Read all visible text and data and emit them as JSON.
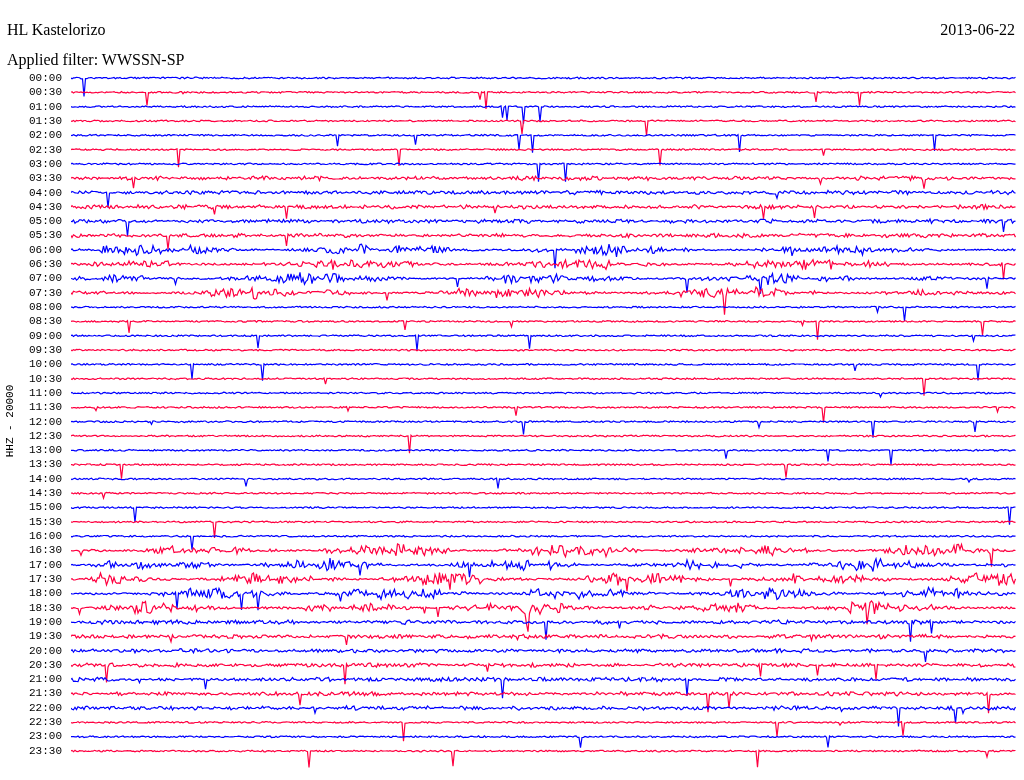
{
  "header": {
    "station": "HL Kastelorizo",
    "date": "2013-06-22",
    "filter": "Applied filter: WWSSN-SP"
  },
  "plot": {
    "axis_label": "HHZ - 20000",
    "rows": [
      {
        "time": "00:00",
        "color": "#0000ff"
      },
      {
        "time": "00:30",
        "color": "#ff0040"
      },
      {
        "time": "01:00",
        "color": "#0000ff"
      },
      {
        "time": "01:30",
        "color": "#ff0040"
      },
      {
        "time": "02:00",
        "color": "#0000ff"
      },
      {
        "time": "02:30",
        "color": "#ff0040"
      },
      {
        "time": "03:00",
        "color": "#0000ff"
      },
      {
        "time": "03:30",
        "color": "#ff0040"
      },
      {
        "time": "04:00",
        "color": "#0000ff"
      },
      {
        "time": "04:30",
        "color": "#ff0040"
      },
      {
        "time": "05:00",
        "color": "#0000ff"
      },
      {
        "time": "05:30",
        "color": "#ff0040"
      },
      {
        "time": "06:00",
        "color": "#0000ff"
      },
      {
        "time": "06:30",
        "color": "#ff0040"
      },
      {
        "time": "07:00",
        "color": "#0000ff"
      },
      {
        "time": "07:30",
        "color": "#ff0040"
      },
      {
        "time": "08:00",
        "color": "#0000ff"
      },
      {
        "time": "08:30",
        "color": "#ff0040"
      },
      {
        "time": "09:00",
        "color": "#0000ff"
      },
      {
        "time": "09:30",
        "color": "#ff0040"
      },
      {
        "time": "10:00",
        "color": "#0000ff"
      },
      {
        "time": "10:30",
        "color": "#ff0040"
      },
      {
        "time": "11:00",
        "color": "#0000ff"
      },
      {
        "time": "11:30",
        "color": "#ff0040"
      },
      {
        "time": "12:00",
        "color": "#0000ff"
      },
      {
        "time": "12:30",
        "color": "#ff0040"
      },
      {
        "time": "13:00",
        "color": "#0000ff"
      },
      {
        "time": "13:30",
        "color": "#ff0040"
      },
      {
        "time": "14:00",
        "color": "#0000ff"
      },
      {
        "time": "14:30",
        "color": "#ff0040"
      },
      {
        "time": "15:00",
        "color": "#0000ff"
      },
      {
        "time": "15:30",
        "color": "#ff0040"
      },
      {
        "time": "16:00",
        "color": "#0000ff"
      },
      {
        "time": "16:30",
        "color": "#ff0040"
      },
      {
        "time": "17:00",
        "color": "#0000ff"
      },
      {
        "time": "17:30",
        "color": "#ff0040"
      },
      {
        "time": "18:00",
        "color": "#0000ff"
      },
      {
        "time": "18:30",
        "color": "#ff0040"
      },
      {
        "time": "19:00",
        "color": "#0000ff"
      },
      {
        "time": "19:30",
        "color": "#ff0040"
      },
      {
        "time": "20:00",
        "color": "#0000ff"
      },
      {
        "time": "20:30",
        "color": "#ff0040"
      },
      {
        "time": "21:00",
        "color": "#0000ff"
      },
      {
        "time": "21:30",
        "color": "#ff0040"
      },
      {
        "time": "22:00",
        "color": "#0000ff"
      },
      {
        "time": "22:30",
        "color": "#ff0040"
      },
      {
        "time": "23:00",
        "color": "#0000ff"
      },
      {
        "time": "23:30",
        "color": "#ff0040"
      }
    ]
  }
}
